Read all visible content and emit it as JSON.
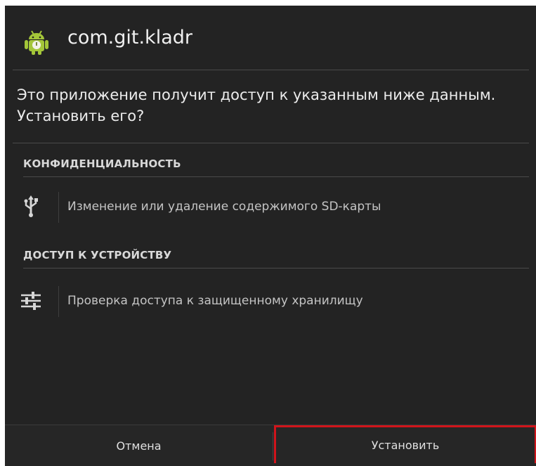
{
  "header": {
    "app_name": "com.git.kladr",
    "app_icon": "android-robot-icon"
  },
  "prompt": {
    "text": "Это приложение получит доступ к указанным ниже данным. Установить его?"
  },
  "sections": [
    {
      "title": "КОНФИДЕНЦИАЛЬНОСТЬ",
      "permissions": [
        {
          "icon": "usb-icon",
          "label": "Изменение или удаление содержимого SD-карты"
        }
      ]
    },
    {
      "title": "ДОСТУП К УСТРОЙСТВУ",
      "permissions": [
        {
          "icon": "settings-sliders-icon",
          "label": "Проверка доступа к защищенному хранилищу"
        }
      ]
    }
  ],
  "buttons": {
    "cancel_label": "Отмена",
    "install_label": "Установить"
  },
  "colors": {
    "background": "#232323",
    "android_green": "#a4c639",
    "highlight_border": "#d0141b"
  }
}
